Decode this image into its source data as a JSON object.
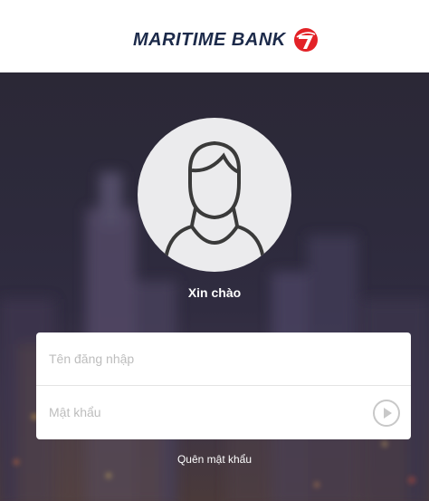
{
  "header": {
    "brand_name": "MARITIME BANK",
    "logo_icon": "maritime-bank-logo-icon",
    "brand_color": "#e32227"
  },
  "profile": {
    "avatar_icon": "user-silhouette-icon",
    "greeting": "Xin chào"
  },
  "login_form": {
    "username_placeholder": "Tên đăng nhập",
    "username_value": "",
    "password_placeholder": "Mật khẩu",
    "password_value": "",
    "submit_icon": "play-arrow-icon"
  },
  "footer": {
    "forgot_password_label": "Quên mật khẩu"
  }
}
